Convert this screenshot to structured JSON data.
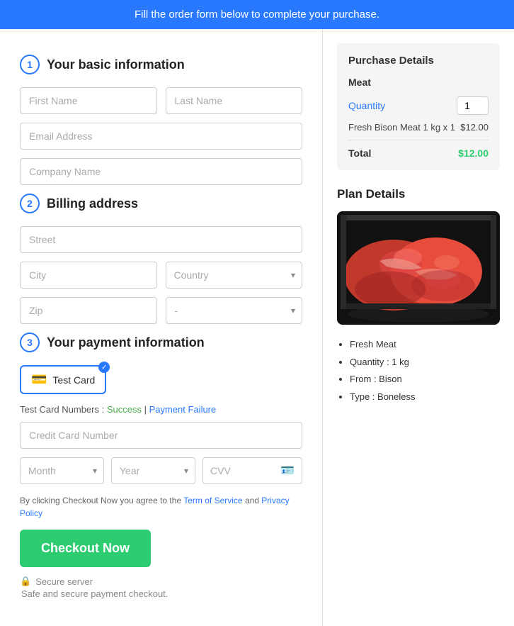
{
  "banner": {
    "text": "Fill the order form below to complete your purchase."
  },
  "sections": {
    "basic_info": {
      "number": "1",
      "title": "Your basic information",
      "first_name_placeholder": "First Name",
      "last_name_placeholder": "Last Name",
      "email_placeholder": "Email Address",
      "company_placeholder": "Company Name"
    },
    "billing": {
      "number": "2",
      "title": "Billing address",
      "street_placeholder": "Street",
      "city_placeholder": "City",
      "country_placeholder": "Country",
      "zip_placeholder": "Zip",
      "state_placeholder": "-"
    },
    "payment": {
      "number": "3",
      "title": "Your payment information",
      "card_label": "Test Card",
      "test_card_prefix": "Test Card Numbers : ",
      "success_link": "Success",
      "separator": " | ",
      "failure_link": "Payment Failure",
      "cc_placeholder": "Credit Card Number",
      "month_placeholder": "Month",
      "year_placeholder": "Year",
      "cvv_placeholder": "CVV",
      "terms_prefix": "By clicking Checkout Now you agree to the ",
      "tos_link": "Term of Service",
      "terms_and": " and ",
      "privacy_link": "Privacy Policy",
      "checkout_btn": "Checkout Now",
      "secure_server": "Secure server",
      "safe_text": "Safe and secure payment checkout."
    }
  },
  "purchase_details": {
    "title": "Purchase Details",
    "product_name": "Meat",
    "quantity_label": "Quantity",
    "quantity_value": "1",
    "item_description": "Fresh Bison Meat 1 kg x 1",
    "item_price": "$12.00",
    "total_label": "Total",
    "total_amount": "$12.00"
  },
  "plan_details": {
    "title": "Plan Details",
    "bullets": [
      "Fresh Meat",
      "Quantity : 1 kg",
      "From : Bison",
      "Type : Boneless"
    ]
  },
  "colors": {
    "blue": "#2979ff",
    "green": "#2ecc71",
    "text_dark": "#222",
    "text_gray": "#888"
  }
}
